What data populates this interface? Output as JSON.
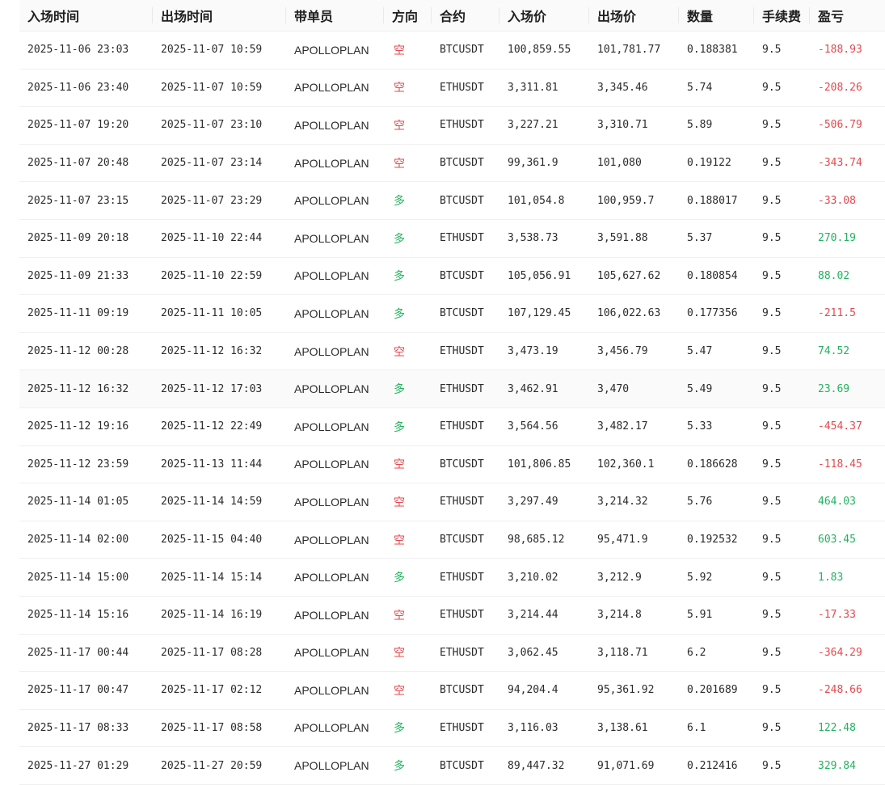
{
  "colors": {
    "short": "#e5484d",
    "long": "#22b35e",
    "loss": "#e5484d",
    "profit": "#22b35e",
    "header_bg": "#fafafa",
    "row_border": "#f0f0f0"
  },
  "table": {
    "headers": {
      "entry_time": "入场时间",
      "exit_time": "出场时间",
      "trader": "带单员",
      "direction": "方向",
      "contract": "合约",
      "entry_price": "入场价",
      "exit_price": "出场价",
      "quantity": "数量",
      "fee": "手续费",
      "pnl": "盈亏"
    },
    "rows": [
      {
        "entry_time": "2025-11-06 23:03",
        "exit_time": "2025-11-07 10:59",
        "trader": "APOLLOPLAN",
        "direction": "空",
        "contract": "BTCUSDT",
        "entry_price": "100,859.55",
        "exit_price": "101,781.77",
        "quantity": "0.188381",
        "fee": "9.5",
        "pnl": "-188.93"
      },
      {
        "entry_time": "2025-11-06 23:40",
        "exit_time": "2025-11-07 10:59",
        "trader": "APOLLOPLAN",
        "direction": "空",
        "contract": "ETHUSDT",
        "entry_price": "3,311.81",
        "exit_price": "3,345.46",
        "quantity": "5.74",
        "fee": "9.5",
        "pnl": "-208.26"
      },
      {
        "entry_time": "2025-11-07 19:20",
        "exit_time": "2025-11-07 23:10",
        "trader": "APOLLOPLAN",
        "direction": "空",
        "contract": "ETHUSDT",
        "entry_price": "3,227.21",
        "exit_price": "3,310.71",
        "quantity": "5.89",
        "fee": "9.5",
        "pnl": "-506.79"
      },
      {
        "entry_time": "2025-11-07 20:48",
        "exit_time": "2025-11-07 23:14",
        "trader": "APOLLOPLAN",
        "direction": "空",
        "contract": "BTCUSDT",
        "entry_price": "99,361.9",
        "exit_price": "101,080",
        "quantity": "0.19122",
        "fee": "9.5",
        "pnl": "-343.74"
      },
      {
        "entry_time": "2025-11-07 23:15",
        "exit_time": "2025-11-07 23:29",
        "trader": "APOLLOPLAN",
        "direction": "多",
        "contract": "BTCUSDT",
        "entry_price": "101,054.8",
        "exit_price": "100,959.7",
        "quantity": "0.188017",
        "fee": "9.5",
        "pnl": "-33.08"
      },
      {
        "entry_time": "2025-11-09 20:18",
        "exit_time": "2025-11-10 22:44",
        "trader": "APOLLOPLAN",
        "direction": "多",
        "contract": "ETHUSDT",
        "entry_price": "3,538.73",
        "exit_price": "3,591.88",
        "quantity": "5.37",
        "fee": "9.5",
        "pnl": "270.19"
      },
      {
        "entry_time": "2025-11-09 21:33",
        "exit_time": "2025-11-10 22:59",
        "trader": "APOLLOPLAN",
        "direction": "多",
        "contract": "BTCUSDT",
        "entry_price": "105,056.91",
        "exit_price": "105,627.62",
        "quantity": "0.180854",
        "fee": "9.5",
        "pnl": "88.02"
      },
      {
        "entry_time": "2025-11-11 09:19",
        "exit_time": "2025-11-11 10:05",
        "trader": "APOLLOPLAN",
        "direction": "多",
        "contract": "BTCUSDT",
        "entry_price": "107,129.45",
        "exit_price": "106,022.63",
        "quantity": "0.177356",
        "fee": "9.5",
        "pnl": "-211.5"
      },
      {
        "entry_time": "2025-11-12 00:28",
        "exit_time": "2025-11-12 16:32",
        "trader": "APOLLOPLAN",
        "direction": "空",
        "contract": "ETHUSDT",
        "entry_price": "3,473.19",
        "exit_price": "3,456.79",
        "quantity": "5.47",
        "fee": "9.5",
        "pnl": "74.52"
      },
      {
        "entry_time": "2025-11-12 16:32",
        "exit_time": "2025-11-12 17:03",
        "trader": "APOLLOPLAN",
        "direction": "多",
        "contract": "ETHUSDT",
        "entry_price": "3,462.91",
        "exit_price": "3,470",
        "quantity": "5.49",
        "fee": "9.5",
        "pnl": "23.69",
        "highlight": true
      },
      {
        "entry_time": "2025-11-12 19:16",
        "exit_time": "2025-11-12 22:49",
        "trader": "APOLLOPLAN",
        "direction": "多",
        "contract": "ETHUSDT",
        "entry_price": "3,564.56",
        "exit_price": "3,482.17",
        "quantity": "5.33",
        "fee": "9.5",
        "pnl": "-454.37"
      },
      {
        "entry_time": "2025-11-12 23:59",
        "exit_time": "2025-11-13 11:44",
        "trader": "APOLLOPLAN",
        "direction": "空",
        "contract": "BTCUSDT",
        "entry_price": "101,806.85",
        "exit_price": "102,360.1",
        "quantity": "0.186628",
        "fee": "9.5",
        "pnl": "-118.45"
      },
      {
        "entry_time": "2025-11-14 01:05",
        "exit_time": "2025-11-14 14:59",
        "trader": "APOLLOPLAN",
        "direction": "空",
        "contract": "ETHUSDT",
        "entry_price": "3,297.49",
        "exit_price": "3,214.32",
        "quantity": "5.76",
        "fee": "9.5",
        "pnl": "464.03"
      },
      {
        "entry_time": "2025-11-14 02:00",
        "exit_time": "2025-11-15 04:40",
        "trader": "APOLLOPLAN",
        "direction": "空",
        "contract": "BTCUSDT",
        "entry_price": "98,685.12",
        "exit_price": "95,471.9",
        "quantity": "0.192532",
        "fee": "9.5",
        "pnl": "603.45"
      },
      {
        "entry_time": "2025-11-14 15:00",
        "exit_time": "2025-11-14 15:14",
        "trader": "APOLLOPLAN",
        "direction": "多",
        "contract": "ETHUSDT",
        "entry_price": "3,210.02",
        "exit_price": "3,212.9",
        "quantity": "5.92",
        "fee": "9.5",
        "pnl": "1.83"
      },
      {
        "entry_time": "2025-11-14 15:16",
        "exit_time": "2025-11-14 16:19",
        "trader": "APOLLOPLAN",
        "direction": "空",
        "contract": "ETHUSDT",
        "entry_price": "3,214.44",
        "exit_price": "3,214.8",
        "quantity": "5.91",
        "fee": "9.5",
        "pnl": "-17.33"
      },
      {
        "entry_time": "2025-11-17 00:44",
        "exit_time": "2025-11-17 08:28",
        "trader": "APOLLOPLAN",
        "direction": "空",
        "contract": "ETHUSDT",
        "entry_price": "3,062.45",
        "exit_price": "3,118.71",
        "quantity": "6.2",
        "fee": "9.5",
        "pnl": "-364.29"
      },
      {
        "entry_time": "2025-11-17 00:47",
        "exit_time": "2025-11-17 02:12",
        "trader": "APOLLOPLAN",
        "direction": "空",
        "contract": "BTCUSDT",
        "entry_price": "94,204.4",
        "exit_price": "95,361.92",
        "quantity": "0.201689",
        "fee": "9.5",
        "pnl": "-248.66"
      },
      {
        "entry_time": "2025-11-17 08:33",
        "exit_time": "2025-11-17 08:58",
        "trader": "APOLLOPLAN",
        "direction": "多",
        "contract": "ETHUSDT",
        "entry_price": "3,116.03",
        "exit_price": "3,138.61",
        "quantity": "6.1",
        "fee": "9.5",
        "pnl": "122.48"
      },
      {
        "entry_time": "2025-11-27 01:29",
        "exit_time": "2025-11-27 20:59",
        "trader": "APOLLOPLAN",
        "direction": "多",
        "contract": "BTCUSDT",
        "entry_price": "89,447.32",
        "exit_price": "91,071.69",
        "quantity": "0.212416",
        "fee": "9.5",
        "pnl": "329.84"
      }
    ]
  }
}
